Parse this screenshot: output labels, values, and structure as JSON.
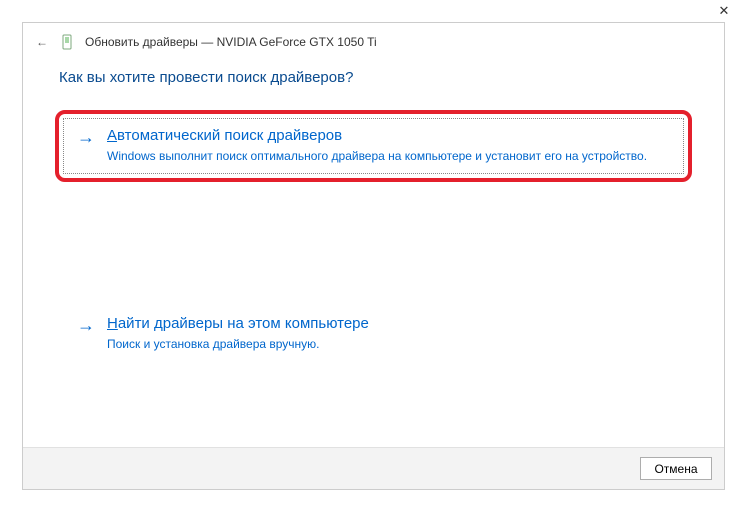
{
  "titlebar": {
    "close_glyph": "✕"
  },
  "header": {
    "back_glyph": "←",
    "title": "Обновить драйверы — NVIDIA GeForce GTX 1050 Ti"
  },
  "content": {
    "question": "Как вы хотите провести поиск драйверов?",
    "options": [
      {
        "arrow": "→",
        "title_uline": "А",
        "title_rest": "втоматический поиск драйверов",
        "desc": "Windows выполнит поиск оптимального драйвера на компьютере и установит его на устройство."
      },
      {
        "arrow": "→",
        "title_uline": "Н",
        "title_rest": "айти драйверы на этом компьютере",
        "desc": "Поиск и установка драйвера вручную."
      }
    ]
  },
  "footer": {
    "cancel_label": "Отмена"
  }
}
